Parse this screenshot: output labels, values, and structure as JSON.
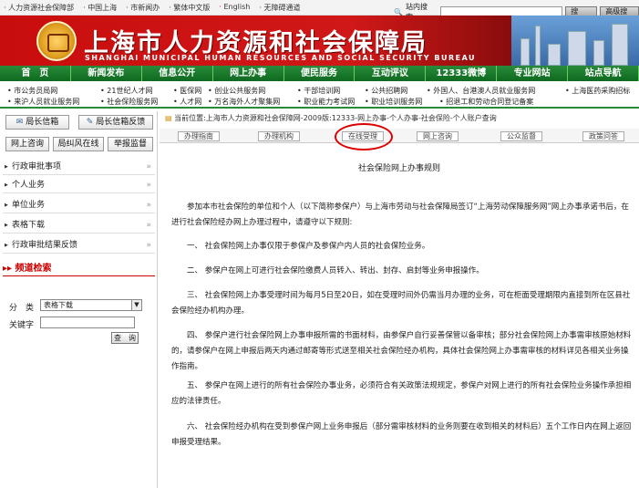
{
  "topbar": {
    "links": [
      "人力资源社会保障部",
      "中国上海",
      "市新闻办",
      "繁体中文版",
      "English",
      "无障碍通道"
    ],
    "search_label": "站内搜索",
    "search_button": "搜　索",
    "advanced_button": "高级搜索"
  },
  "banner": {
    "title": "上海市人力资源和社会保障局",
    "subtitle": "SHANGHAI MUNICIPAL HUMAN RESOURCES AND SOCIAL SECURITY BUREAU"
  },
  "nav": [
    "首　页",
    "新闻发布",
    "信息公开",
    "网上办事",
    "便民服务",
    "互动评议",
    "12333微博",
    "专业网站",
    "站点导航"
  ],
  "links_row1": [
    "市公务员局网",
    "21世纪人才网",
    "医保网",
    "创业公共服务网",
    "干部培训网",
    "公共招聘网",
    "外国人、台港澳人员就业服务网",
    "上海医药采购招标"
  ],
  "links_row2": [
    "来沪人员就业服务网",
    "社会保险服务网",
    "人才网",
    "万名海外人才聚集网",
    "职业能力考试网",
    "职业培训服务网",
    "招退工和劳动合同登记备案"
  ],
  "left": {
    "quick": [
      "局长信箱",
      "局长信箱反馈",
      "网上咨询",
      "局纠风在线",
      "举报监督"
    ],
    "menu": [
      "行政审批事项",
      "个人业务",
      "单位业务",
      "表格下载",
      "行政审批结果反馈"
    ],
    "channel_title": "频道检索",
    "category_label": "分　类",
    "category_value": "表格下载",
    "keyword_label": "关键字",
    "query_button": "查　询"
  },
  "main": {
    "breadcrumb": "当前位置:上海市人力资源和社会保障网-2009版:12333-网上办事-个人办事-社会保险-个人账户查询",
    "tabs": [
      "办理指南",
      "办理机构",
      "在线受理",
      "网上咨询",
      "公众监督",
      "政策问答"
    ],
    "content_title": "社会保险网上办事规则",
    "paragraphs": [
      "参加本市社会保险的单位和个人（以下简称参保户）与上海市劳动与社会保障局签订“上海劳动保障服务网”网上办事承诺书后，在进行社会保险经办网上办理过程中，请遵守以下规则:",
      "一、 社会保险网上办事仅限于参保户及参保户内人员的社会保险业务。",
      "二、 参保户在网上可进行社会保险缴费人员转入、转出、封存、启封等业务申报操作。",
      "三、 社会保险网上办事受理时间为每月5日至20日，如在受理时间外仍需当月办理的业务，可在柜面受理期限内直接到所在区县社会保险经办机构办理。",
      "四、 参保户进行社会保险网上办事申报所需的书面材料，由参保户自行妥善保管以备审核；部分社会保险网上办事需审核原始材料的，请参保户在网上申报后两天内通过邮寄等形式送至相关社会保险经办机构，具体社会保险网上办事需审核的材料详见各相关业务操作指南。",
      "五、 参保户在网上进行的所有社会保险办事业务，必须符合有关政策法规规定，参保户对网上进行的所有社会保险业务操作承担相应的法律责任。",
      "六、 社会保险经办机构在受到参保户网上业务申报后（部分需审核材料的业务则要在收到相关的材料后）五个工作日内在网上返回申报受理结果。"
    ]
  },
  "colors": {
    "brand_red": "#c90d0d",
    "nav_green": "#0d6a1f",
    "annotation_circle": "#dd0000"
  }
}
